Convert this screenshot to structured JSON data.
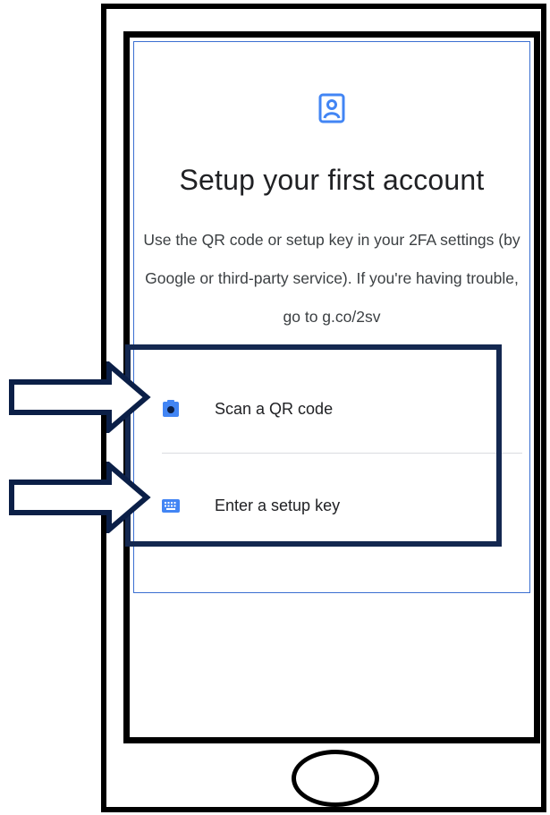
{
  "page": {
    "title": "Setup your first account",
    "description": "Use the QR code or setup key in your 2FA settings (by Google or third-party service). If you're having trouble, go to g.co/2sv"
  },
  "options": [
    {
      "label": "Scan a QR code",
      "icon": "camera-icon"
    },
    {
      "label": "Enter a setup key",
      "icon": "keyboard-icon"
    }
  ],
  "colors": {
    "accent": "#4285f4",
    "card_border": "#3b6fd1",
    "annotation": "#142850",
    "text": "#202124"
  }
}
